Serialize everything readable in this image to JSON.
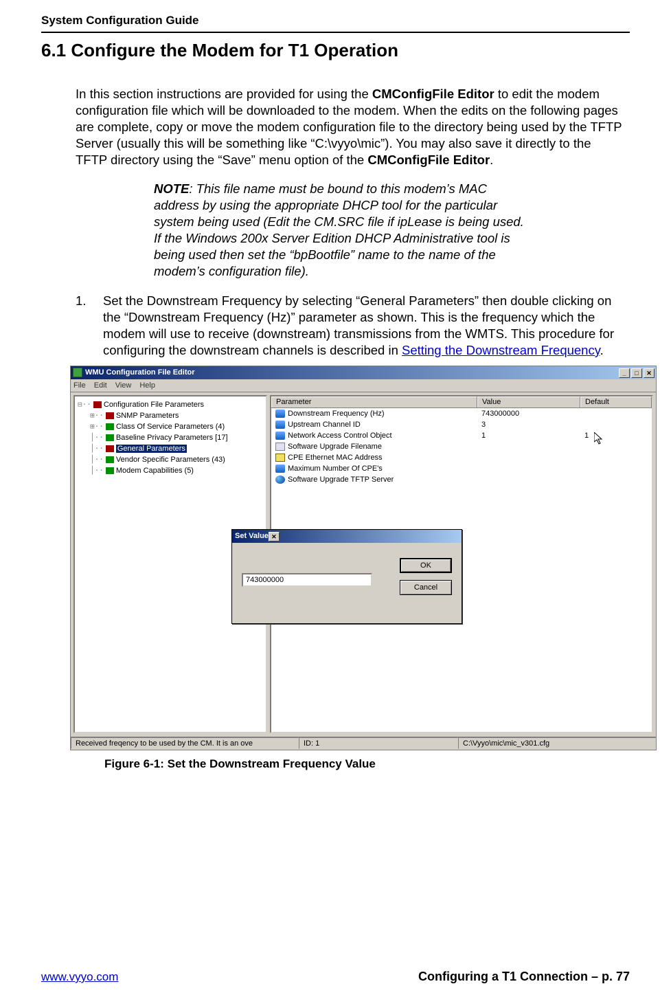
{
  "doc_header": "System Configuration Guide",
  "section_heading": "6.1  Configure the Modem for T1 Operation",
  "intro": {
    "p1a": "In this section instructions are provided for using the ",
    "p1b": "CMConfigFile Editor",
    "p1c": " to edit the modem configuration file which will be downloaded to the modem.  When the edits on the following pages are complete, copy or move the modem configuration file to the directory being used by the TFTP Server (usually this will be something like “C:\\vyyo\\mic”).  You may also save it directly to the TFTP directory using the “Save” menu option of the  ",
    "p1d": "CMConfigFile Editor",
    "p1e": "."
  },
  "note": {
    "label": "NOTE",
    "text": ": This file name must be bound to this modem’s MAC address by using the appropriate DHCP tool for the particular system being used (Edit the CM.SRC file if ipLease is being used. If the Windows 200x Server Edition DHCP Administrative tool is being used then set the “bpBootfile” name to the name of the modem’s configuration file)."
  },
  "step1": {
    "num": "1.",
    "t1": "Set the Downstream Frequency by selecting “General Parameters” then double clicking on the “Downstream Frequency (Hz)” parameter as shown.  This is the frequency which the modem will use to receive (downstream) transmissions from the WMTS.  This procedure for configuring the downstream channels is described in ",
    "link": "Setting the Downstream Frequency",
    "t2": "."
  },
  "app": {
    "title": "WMU Configuration File Editor",
    "menus": [
      "File",
      "Edit",
      "View",
      "Help"
    ],
    "winbtns": {
      "min": "_",
      "max": "□",
      "close": "✕"
    },
    "tree": [
      {
        "indent": 0,
        "conn": "−",
        "icon": "folder",
        "label": "Configuration File Parameters"
      },
      {
        "indent": 1,
        "conn": "+",
        "icon": "folder",
        "label": "SNMP Parameters"
      },
      {
        "indent": 1,
        "conn": "+",
        "icon": "green",
        "label": "Class Of Service Parameters (4)"
      },
      {
        "indent": 1,
        "conn": "·",
        "icon": "green",
        "label": "Baseline Privacy Parameters [17]"
      },
      {
        "indent": 1,
        "conn": "·",
        "icon": "folder",
        "label": "General Parameters",
        "selected": true
      },
      {
        "indent": 1,
        "conn": "·",
        "icon": "green",
        "label": "Vendor Specific Parameters (43)"
      },
      {
        "indent": 1,
        "conn": "·",
        "icon": "green",
        "label": "Modem Capabilities (5)"
      }
    ],
    "columns": {
      "param": "Parameter",
      "value": "Value",
      "default": "Default"
    },
    "rows": [
      {
        "icon": "blue",
        "param": "Downstream Frequency  (Hz)",
        "value": "743000000",
        "default": ""
      },
      {
        "icon": "blue",
        "param": "Upstream Channel ID",
        "value": "3",
        "default": ""
      },
      {
        "icon": "blue",
        "param": "Network Access Control Object",
        "value": "1",
        "default": "1"
      },
      {
        "icon": "wrench",
        "param": "Software Upgrade Filename",
        "value": "",
        "default": ""
      },
      {
        "icon": "card",
        "param": "CPE Ethernet MAC Address",
        "value": "",
        "default": ""
      },
      {
        "icon": "blue",
        "param": "Maximum Number Of CPE's",
        "value": "",
        "default": ""
      },
      {
        "icon": "globe",
        "param": "Software Upgrade TFTP Server",
        "value": "",
        "default": ""
      }
    ],
    "dialog": {
      "title": "Set Value",
      "close": "✕",
      "input": "743000000",
      "ok": "OK",
      "cancel": "Cancel"
    },
    "status": {
      "msg": "Received freqency to be used by the CM.  It is an ove",
      "id": "ID: 1",
      "path": "C:\\Vyyo\\mic\\mic_v301.cfg"
    }
  },
  "figure_caption": "Figure 6-1: Set the Downstream Frequency Value",
  "footer": {
    "link": "www.vyyo.com",
    "right": "Configuring a T1 Connection – p. 77"
  }
}
